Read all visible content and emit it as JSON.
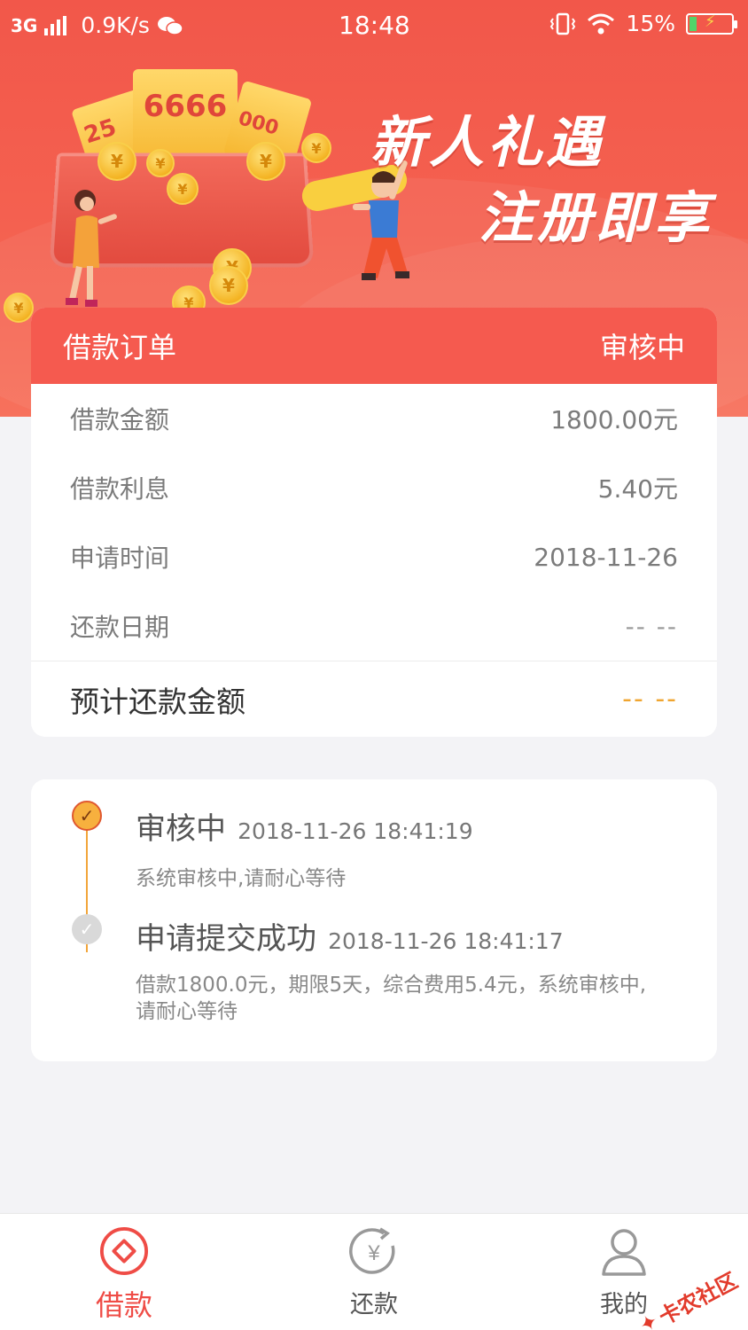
{
  "status_bar": {
    "network": "3G",
    "speed": "0.9K/s",
    "time": "18:48",
    "battery": "15%"
  },
  "banner": {
    "ticket_value": "6666",
    "ticket_side": "25",
    "title_line1": "新人礼遇",
    "title_line2": "注册即享"
  },
  "order": {
    "header_title": "借款订单",
    "header_status": "审核中",
    "rows": [
      {
        "label": "借款金额",
        "value": "1800.00元"
      },
      {
        "label": "借款利息",
        "value": "5.40元"
      },
      {
        "label": "申请时间",
        "value": "2018-11-26"
      },
      {
        "label": "还款日期",
        "value": "-- --"
      }
    ],
    "total_label": "预计还款金额",
    "total_value": "-- --"
  },
  "timeline": [
    {
      "title": "审核中",
      "time": "2018-11-26 18:41:19",
      "desc": "系统审核中,请耐心等待"
    },
    {
      "title": "申请提交成功",
      "time": "2018-11-26 18:41:17",
      "desc": "借款1800.0元，期限5天，综合费用5.4元，系统审核中,请耐心等待"
    }
  ],
  "tabs": [
    {
      "label": "借款",
      "icon": "loan-icon",
      "active": true
    },
    {
      "label": "还款",
      "icon": "repay-icon",
      "active": false
    },
    {
      "label": "我的",
      "icon": "user-icon",
      "active": false
    }
  ],
  "watermark": "卡农社区",
  "colors": {
    "accent": "#f55a4f",
    "pending": "#f0a530",
    "background": "#f3f3f6"
  }
}
